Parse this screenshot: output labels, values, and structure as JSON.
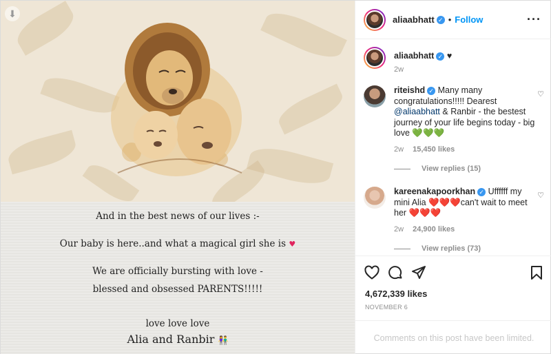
{
  "post": {
    "caption_lines": [
      "And in the best news of our lives :-",
      "Our baby is here..and what a magical girl she is",
      "We are officially bursting with love -",
      "blessed and obsessed PARENTS!!!!!",
      "love love love",
      "Alia and Ranbir"
    ],
    "heart_emoji": "♥",
    "couple_emoji": "👫"
  },
  "header": {
    "username": "aliaabhatt",
    "verified_mark": "✓",
    "separator": "•",
    "follow_label": "Follow",
    "more_label": "···"
  },
  "author_comment": {
    "username": "aliaabhatt",
    "text": "♥",
    "time": "2w"
  },
  "comments": [
    {
      "username": "riteishd",
      "text_a": "Many many congratulations!!!!! Dearest ",
      "mention": "@aliaabhatt",
      "text_b": " & Ranbir - the bestest journey of your life begins today - big love ",
      "emoji": "💚💚💚",
      "time": "2w",
      "likes": "15,450 likes",
      "replies": "View replies (15)"
    },
    {
      "username": "kareenakapoorkhan",
      "text_a": "Uffffff my mini Alia ",
      "emoji_a": "❤️❤️❤️",
      "text_b": "can't wait to meet her ",
      "emoji_b": "❤️❤️❤️",
      "time": "2w",
      "likes": "24,900 likes",
      "replies": "View replies (73)"
    }
  ],
  "stats": {
    "likes": "4,672,339 likes",
    "date": "NOVEMBER 6"
  },
  "footer": {
    "limited_text": "Comments on this post have been limited."
  },
  "icons": [
    "download-icon",
    "verified-icon",
    "more-icon",
    "heart-icon",
    "comment-icon",
    "share-icon",
    "bookmark-icon"
  ],
  "colors": {
    "accent": "#0095f6",
    "verified": "#3897f0",
    "heart": "#e0245e",
    "muted": "#8e8e8e"
  }
}
